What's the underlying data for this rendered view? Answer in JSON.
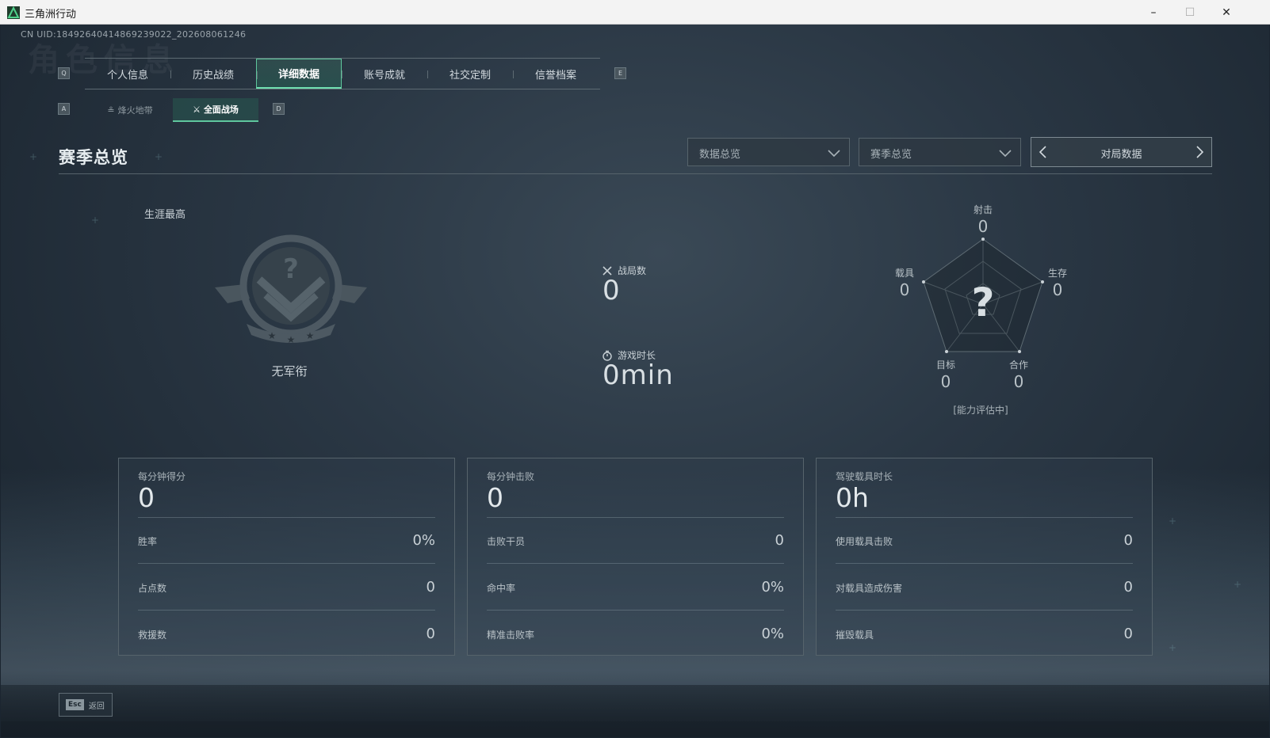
{
  "window": {
    "title": "三角洲行动",
    "minimize": "–",
    "maximize": "☐",
    "close": "✕"
  },
  "header": {
    "uid": "CN UID:18492640414869239022_202608061246",
    "bg_word": "角色信息",
    "key_prev_tab": "Q",
    "key_next_tab": "E",
    "key_prev_sub": "A",
    "key_next_sub": "D"
  },
  "tabs": [
    {
      "label": "个人信息",
      "active": false
    },
    {
      "label": "历史战绩",
      "active": false
    },
    {
      "label": "详细数据",
      "active": true
    },
    {
      "label": "账号成就",
      "active": false
    },
    {
      "label": "社交定制",
      "active": false
    },
    {
      "label": "信誉档案",
      "active": false
    }
  ],
  "subtabs": [
    {
      "label": "烽火地带",
      "icon": "beacon-icon",
      "active": false
    },
    {
      "label": "全面战场",
      "icon": "battlefield-icon",
      "active": true
    }
  ],
  "section": {
    "title": "赛季总览",
    "dropdown1": "数据总览",
    "dropdown2": "赛季总览",
    "pager_label": "对局数据"
  },
  "rank": {
    "caption": "生涯最高",
    "name": "无军衔"
  },
  "summary": {
    "matches_label": "战局数",
    "matches_value": "0",
    "playtime_label": "游戏时长",
    "playtime_value": "0min"
  },
  "radar": {
    "top_label": "射击",
    "top_value": "0",
    "left_label": "载具",
    "left_value": "0",
    "right_label": "生存",
    "right_value": "0",
    "bottom_left_label": "目标",
    "bottom_left_value": "0",
    "bottom_right_label": "合作",
    "bottom_right_value": "0",
    "center_mark": "?",
    "note": "[能力评估中]"
  },
  "cards": [
    {
      "title": "每分钟得分",
      "big": "0",
      "rows": [
        {
          "label": "胜率",
          "value": "0%"
        },
        {
          "label": "占点数",
          "value": "0"
        },
        {
          "label": "救援数",
          "value": "0"
        }
      ]
    },
    {
      "title": "每分钟击败",
      "big": "0",
      "rows": [
        {
          "label": "击败干员",
          "value": "0"
        },
        {
          "label": "命中率",
          "value": "0%"
        },
        {
          "label": "精准击败率",
          "value": "0%"
        }
      ]
    },
    {
      "title": "驾驶载具时长",
      "big": "0h",
      "rows": [
        {
          "label": "使用载具击败",
          "value": "0"
        },
        {
          "label": "对载具造成伤害",
          "value": "0"
        },
        {
          "label": "摧毁载具",
          "value": "0"
        }
      ]
    }
  ],
  "footer": {
    "esc_key": "Esc",
    "back_label": "返回"
  },
  "colors": {
    "accent": "#5fc79e",
    "background": "#1f2a35"
  }
}
